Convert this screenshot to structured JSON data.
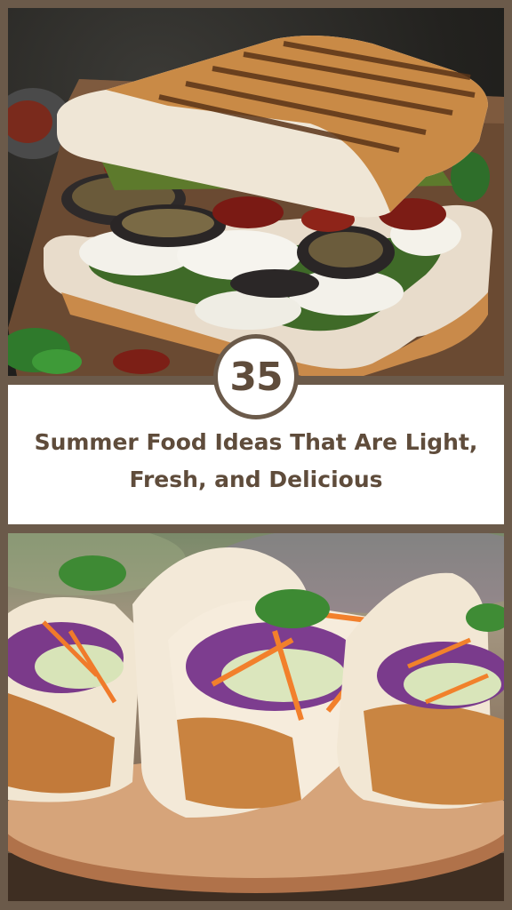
{
  "badge": {
    "number": "35"
  },
  "title": {
    "line1": "Summer Food Ideas That Are Light,",
    "line2": "Fresh, and Delicious"
  },
  "colors": {
    "frame": "#6b5a4a",
    "text": "#5f4c3b",
    "band": "#ffffff"
  }
}
